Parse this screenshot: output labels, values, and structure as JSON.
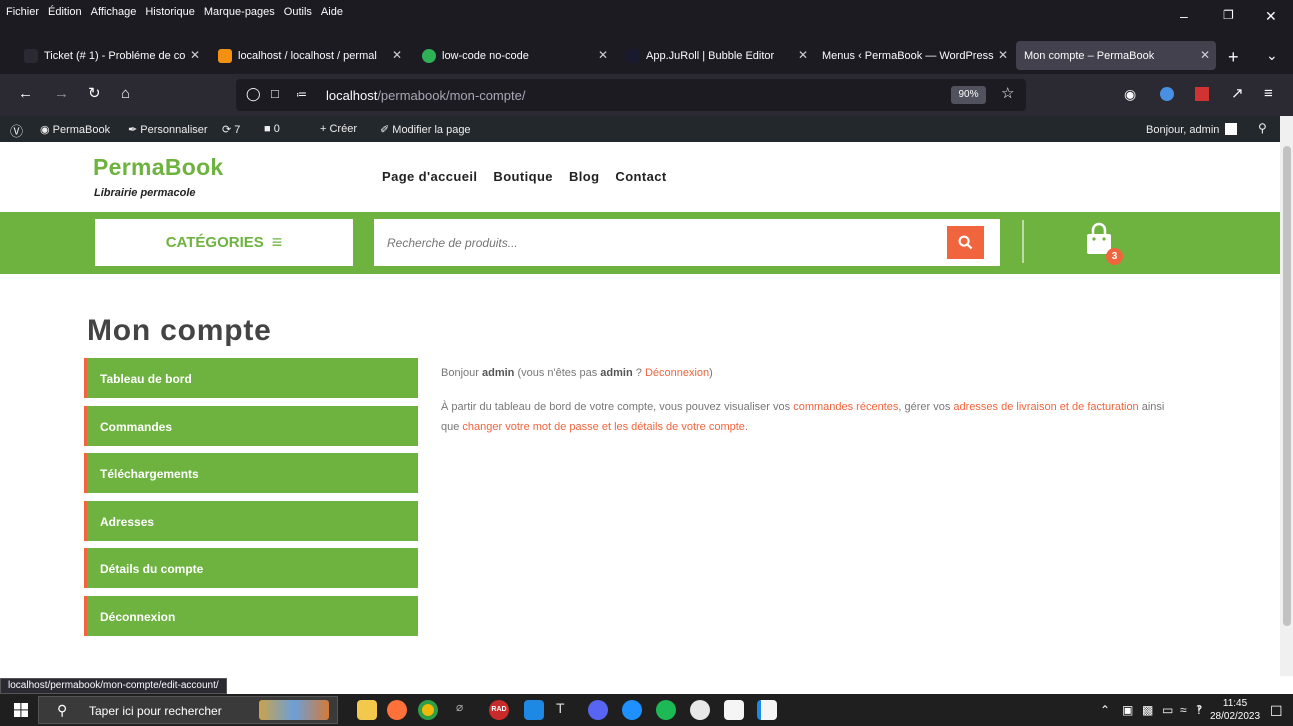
{
  "menubar": {
    "items": [
      "Fichier",
      "Édition",
      "Affichage",
      "Historique",
      "Marque-pages",
      "Outils",
      "Aide"
    ]
  },
  "tabs": [
    {
      "label": "Ticket (# 1) - Probléme de co"
    },
    {
      "label": "localhost / localhost / permal"
    },
    {
      "label": "low-code no-code"
    },
    {
      "label": "App.JuRoll | Bubble Editor"
    },
    {
      "label": "Menus ‹ PermaBook — WordPress"
    },
    {
      "label": "Mon compte – PermaBook"
    }
  ],
  "urlbar": {
    "host": "localhost",
    "path": "/permabook/mon-compte/",
    "zoom": "90%"
  },
  "wpbar": {
    "site": "PermaBook",
    "customize": "Personnaliser",
    "updates": "7",
    "comments": "0",
    "new": "Créer",
    "edit": "Modifier la page",
    "greeting": "Bonjour, admin"
  },
  "site": {
    "title": "PermaBook",
    "tagline": "Librairie permacole",
    "nav": [
      "Page d'accueil",
      "Boutique",
      "Blog",
      "Contact"
    ],
    "categories_label": "CATÉGORIES",
    "search_placeholder": "Recherche de produits...",
    "cart_count": "3"
  },
  "account": {
    "title": "Mon compte",
    "menu": [
      "Tableau de bord",
      "Commandes",
      "Téléchargements",
      "Adresses",
      "Détails du compte",
      "Déconnexion"
    ],
    "hello_prefix": "Bonjour",
    "user": "admin",
    "not_prefix": "(vous n'êtes pas",
    "not_user": "admin",
    "not_suffix": "?",
    "logout_link": "Déconnexion",
    "close_paren": ")",
    "dash_1": "À partir du tableau de bord de votre compte, vous pouvez visualiser vos",
    "dash_link_orders": "commandes récentes",
    "dash_2": ", gérer vos",
    "dash_link_addresses": "adresses de livraison et de facturation",
    "dash_3": "ainsi que",
    "dash_link_account": "changer votre mot de passe et les détails de votre compte",
    "dash_4": "."
  },
  "status_url": "localhost/permabook/mon-compte/edit-account/",
  "taskbar": {
    "search_placeholder": "Taper ici pour rechercher",
    "time": "11:45",
    "date": "28/02/2023"
  },
  "colors": {
    "brand_green": "#6eb33f",
    "accent_orange": "#f0653e"
  }
}
